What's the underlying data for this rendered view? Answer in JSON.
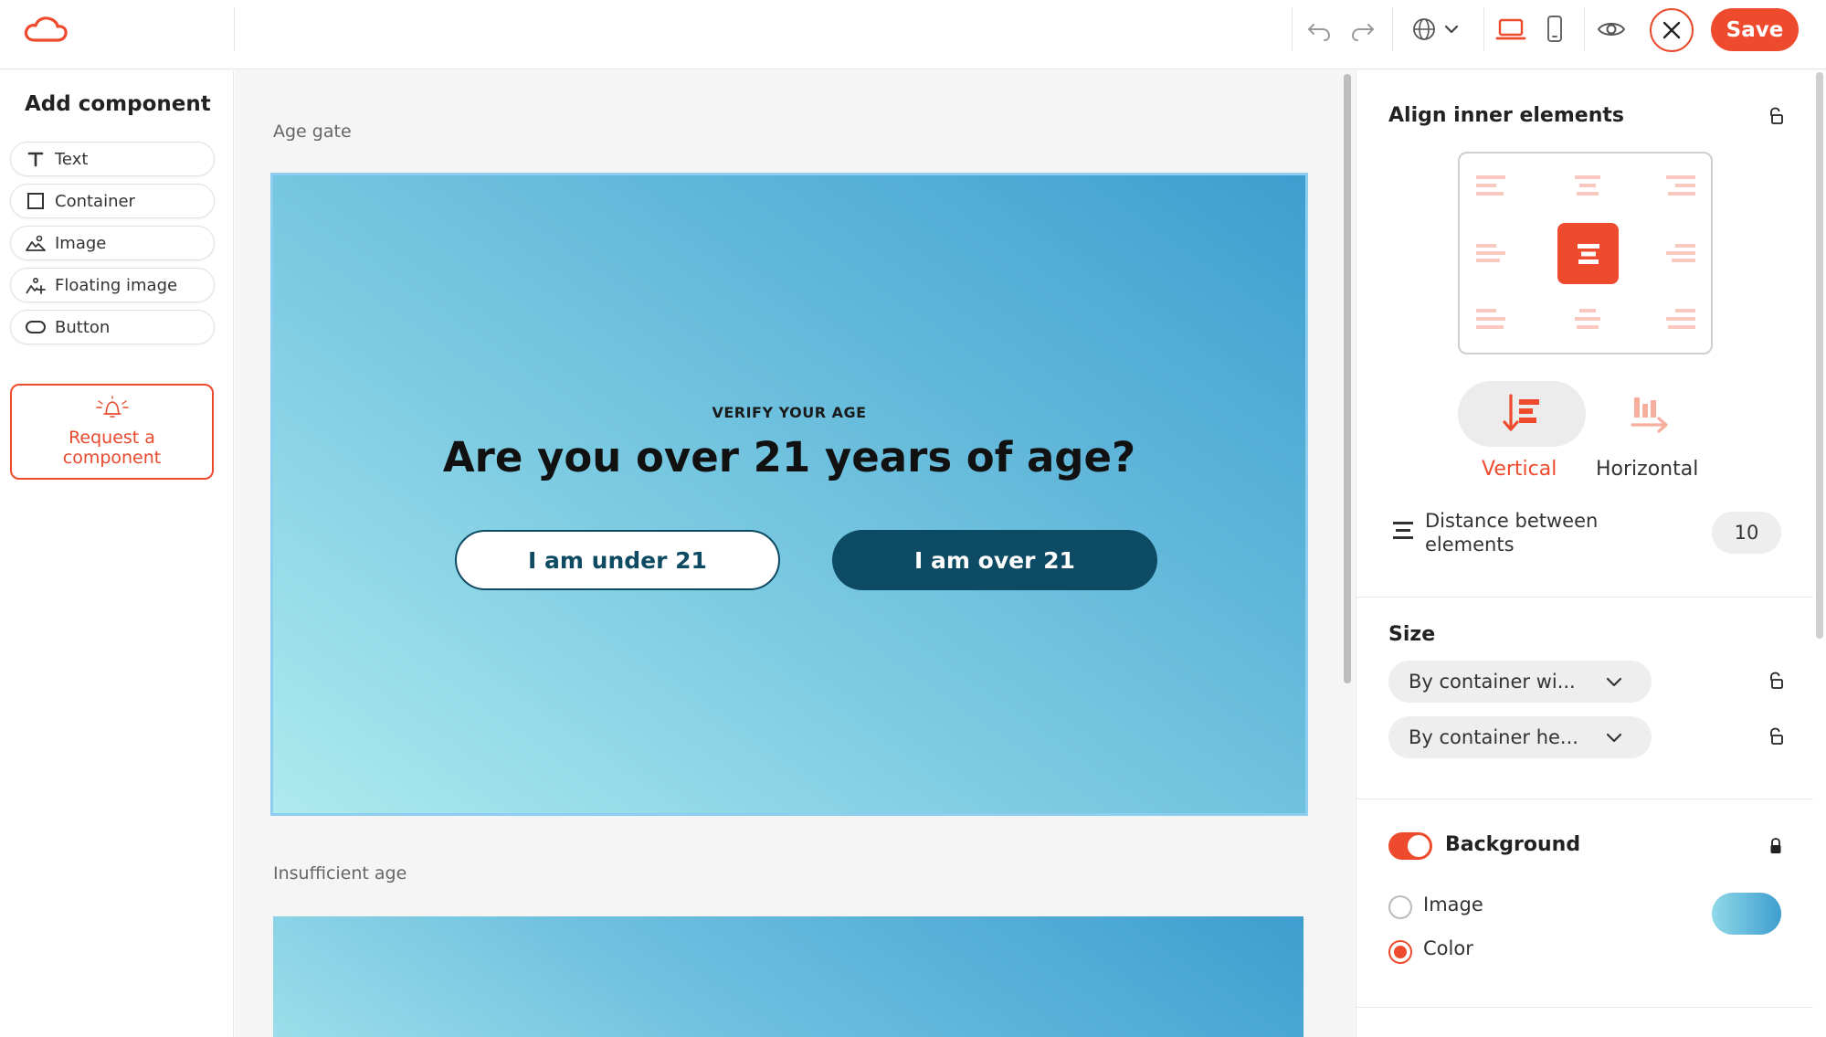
{
  "toolbar": {
    "save_label": "Save"
  },
  "left_sidebar": {
    "title": "Add component",
    "components": [
      {
        "label": "Text",
        "icon": "text-icon"
      },
      {
        "label": "Container",
        "icon": "container-icon"
      },
      {
        "label": "Image",
        "icon": "image-icon"
      },
      {
        "label": "Floating image",
        "icon": "floating-image-icon"
      },
      {
        "label": "Button",
        "icon": "button-icon"
      }
    ],
    "request_label_line1": "Request a",
    "request_label_line2": "component"
  },
  "canvas": {
    "sections": [
      {
        "label": "Age gate",
        "eyebrow": "VERIFY YOUR AGE",
        "headline": "Are you over 21 years of age?",
        "buttons": [
          {
            "label": "I am under 21"
          },
          {
            "label": "I am over 21"
          }
        ]
      },
      {
        "label": "Insufficient age"
      }
    ]
  },
  "right_panel": {
    "align": {
      "title": "Align inner elements",
      "vertical_label": "Vertical",
      "horizontal_label": "Horizontal",
      "distance_label": "Distance between elements",
      "distance_value": "10"
    },
    "size": {
      "title": "Size",
      "width_option": "By container wi...",
      "height_option": "By container he..."
    },
    "background": {
      "title": "Background",
      "enabled": true,
      "options": [
        {
          "label": "Image",
          "selected": false
        },
        {
          "label": "Color",
          "selected": true
        }
      ]
    }
  },
  "colors": {
    "accent": "#ee4a2d",
    "dark_teal": "#0d4a63"
  }
}
